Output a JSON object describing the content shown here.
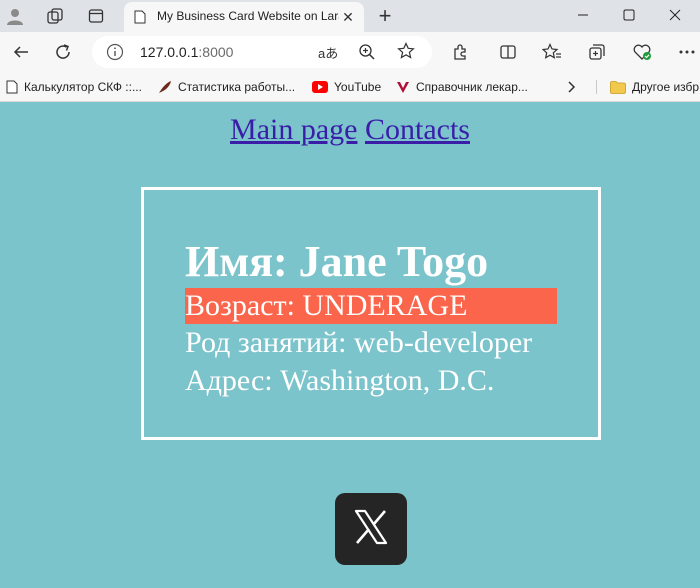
{
  "browser": {
    "tab": {
      "title": "My Business Card Website on Laravel"
    },
    "address_bar": {
      "host": "127.0.0.1",
      "port": ":8000"
    },
    "bookmarks": [
      {
        "label": "Калькулятор СКФ ::...",
        "icon": "document-icon"
      },
      {
        "label": "Статистика работы...",
        "icon": "feather-icon"
      },
      {
        "label": "YouTube",
        "icon": "youtube-icon"
      },
      {
        "label": "Справочник лекар...",
        "icon": "vidal-icon"
      }
    ],
    "other_bookmarks": "Другое избр",
    "colors": {
      "tabstrip": "#dfe3e8",
      "toolbar": "#f7f7f7"
    }
  },
  "page": {
    "nav": {
      "main": "Main page",
      "contacts": "Contacts"
    },
    "card": {
      "name": "Имя: Jane Togo",
      "age": "Возраст: UNDERAGE",
      "occupation": "Род занятий: web-developer",
      "address": "Адрес: Washington, D.C."
    },
    "social": {
      "icon": "x-logo-icon"
    },
    "colors": {
      "background": "#7bc4cc",
      "age_highlight": "#fa654b",
      "link": "#3a1ea8"
    }
  }
}
